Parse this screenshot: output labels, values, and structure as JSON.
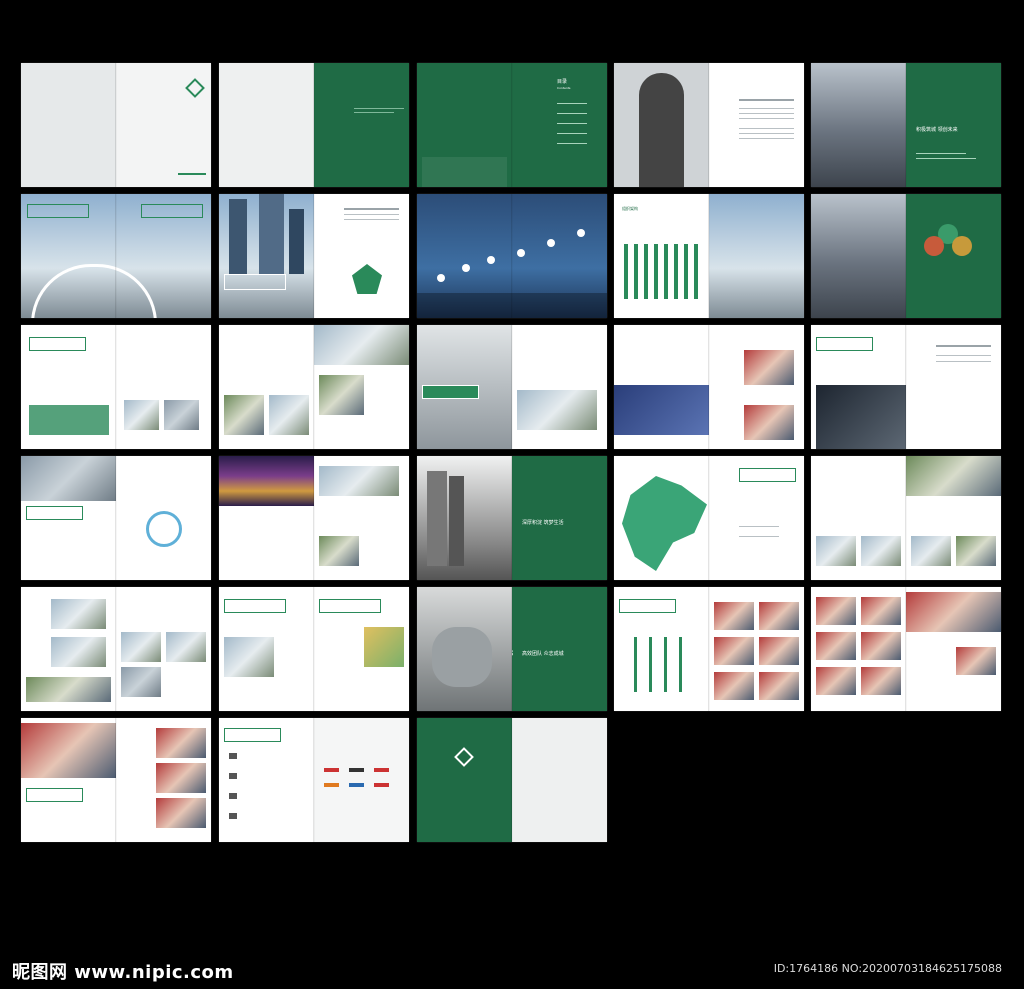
{
  "watermark": {
    "site": "昵图网 www.nipic.com"
  },
  "image_id": {
    "text": "ID:1764186 NO:20200703184625175088"
  },
  "chapters": [
    {
      "num": "01",
      "title": "积极筑城 领创未来"
    },
    {
      "num": "02",
      "title": "深厚积淀 筑梦生活"
    },
    {
      "num": "03",
      "title": "高效团队 众志成城"
    }
  ],
  "contents": {
    "title": "目录",
    "subtitle": "Contents"
  },
  "org_chart": {
    "title": "组织架构"
  },
  "colors": {
    "brand_green": "#1f6b45",
    "accent_green": "#2a8a5a",
    "background": "#000000"
  }
}
